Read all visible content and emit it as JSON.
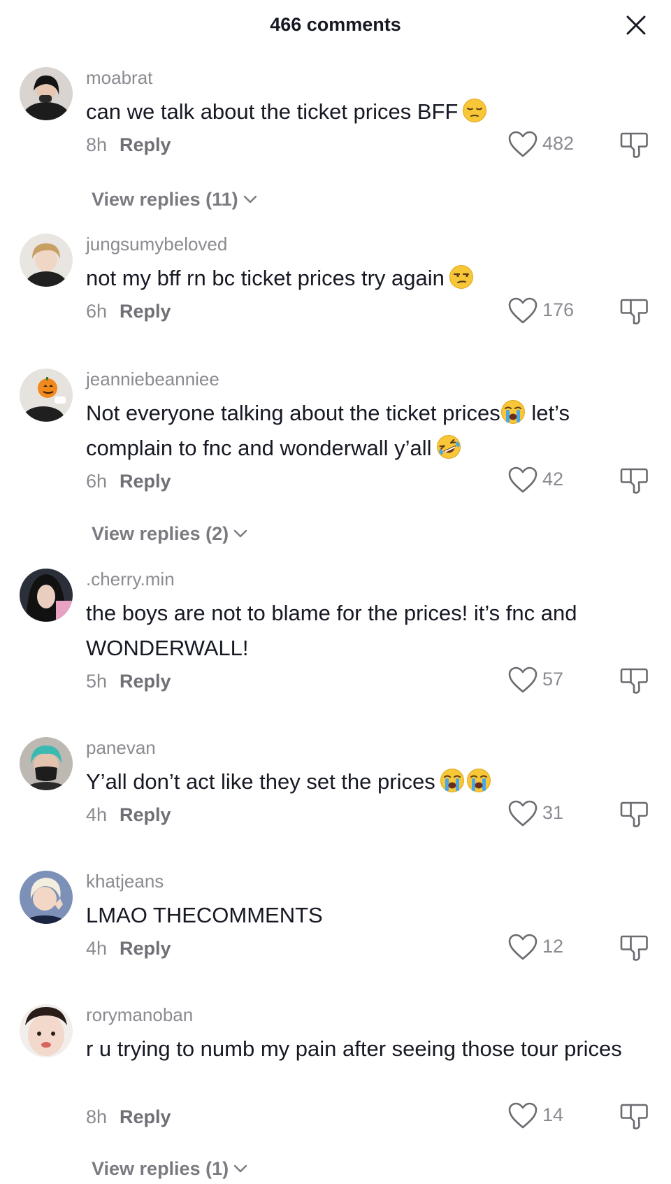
{
  "header": {
    "title": "466 comments",
    "close_icon": "close-icon"
  },
  "comments": [
    {
      "username": "moabrat",
      "text": "can we talk about the ticket prices BFF",
      "emojis": [
        "pensive-face"
      ],
      "time": "8h",
      "reply_label": "Reply",
      "likes": "482",
      "view_replies": "View replies (11)"
    },
    {
      "username": "jungsumybeloved",
      "text": "not my bff rn bc ticket prices try again",
      "emojis": [
        "unamused-face"
      ],
      "time": "6h",
      "reply_label": "Reply",
      "likes": "176"
    },
    {
      "username": "jeanniebeanniee",
      "text_part1": "Not everyone talking about the ticket prices",
      "text_part2": " let’s complain to fnc and wonderwall y’all",
      "emojis": [
        "loudly-crying-face",
        "rolling-on-floor-laughing"
      ],
      "time": "6h",
      "reply_label": "Reply",
      "likes": "42",
      "view_replies": "View replies (2)"
    },
    {
      "username": ".cherry.min",
      "text": "the boys are not to blame for the prices! it’s fnc and WONDERWALL!",
      "time": "5h",
      "reply_label": "Reply",
      "likes": "57"
    },
    {
      "username": "panevan",
      "text": "Y’all don’t act like they set the prices",
      "emojis": [
        "loudly-crying-face",
        "loudly-crying-face"
      ],
      "time": "4h",
      "reply_label": "Reply",
      "likes": "31"
    },
    {
      "username": "khatjeans",
      "text": "LMAO THECOMMENTS",
      "time": "4h",
      "reply_label": "Reply",
      "likes": "12"
    },
    {
      "username": "rorymanoban",
      "text": "r u trying to numb my pain after seeing those tour prices",
      "time": "8h",
      "reply_label": "Reply",
      "likes": "14",
      "view_replies": "View replies (1)"
    }
  ],
  "colors": {
    "primary_text": "#161823",
    "secondary_text": "#8a8b91",
    "reply_text": "#6f7076",
    "background": "#ffffff"
  }
}
